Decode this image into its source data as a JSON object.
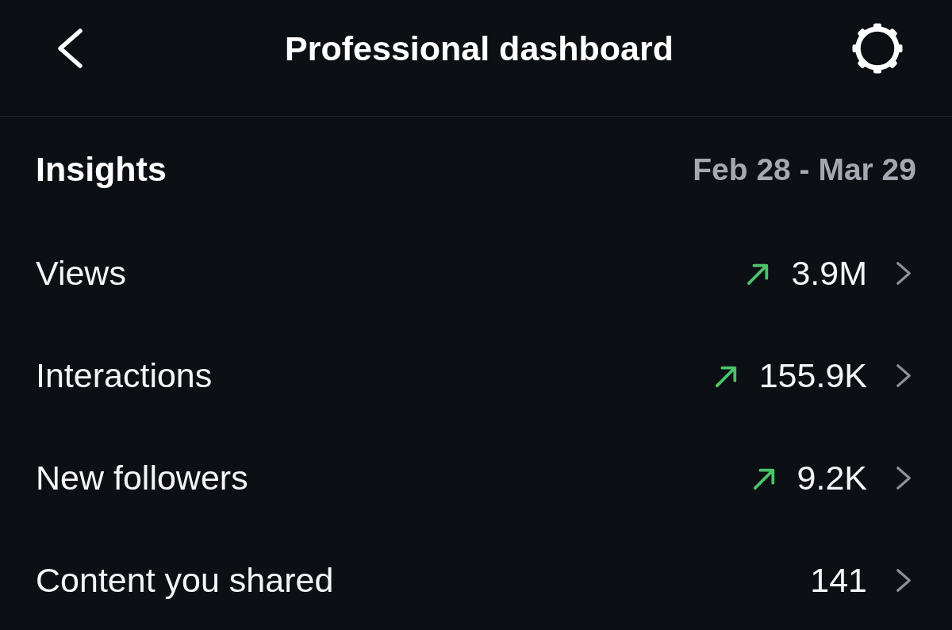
{
  "header": {
    "title": "Professional dashboard"
  },
  "insights": {
    "title": "Insights",
    "date_range": "Feb 28 - Mar 29",
    "metrics": [
      {
        "label": "Views",
        "value": "3.9M",
        "trending_up": true
      },
      {
        "label": "Interactions",
        "value": "155.9K",
        "trending_up": true
      },
      {
        "label": "New followers",
        "value": "9.2K",
        "trending_up": true
      },
      {
        "label": "Content you shared",
        "value": "141",
        "trending_up": false
      }
    ]
  }
}
